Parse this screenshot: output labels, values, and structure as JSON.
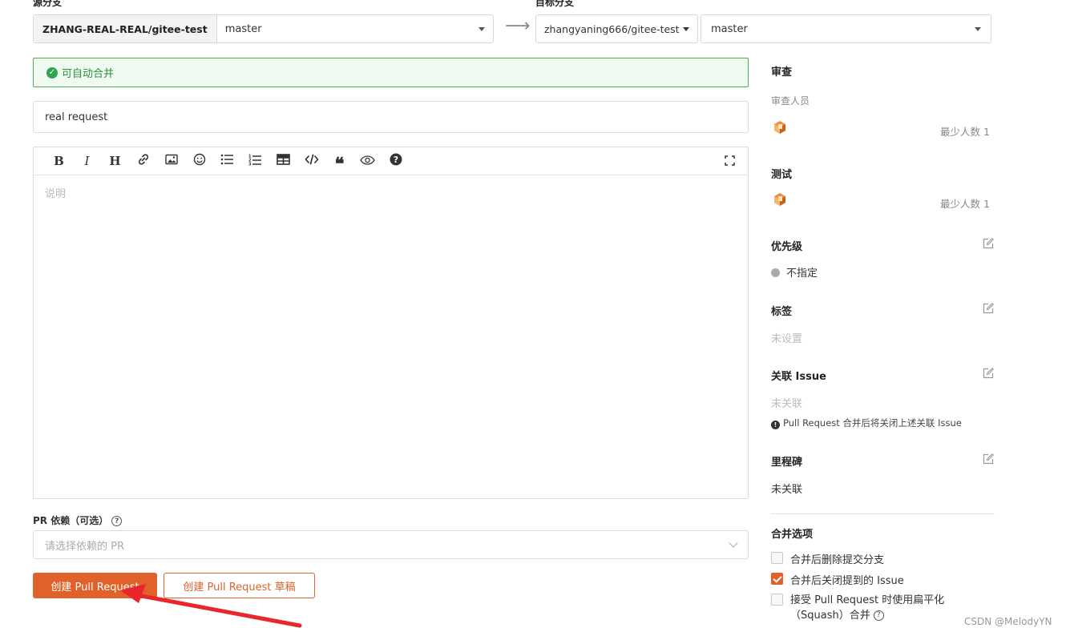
{
  "source": {
    "label": "源分支",
    "repo": "ZHANG-REAL-REAL/gitee-test",
    "branch": "master"
  },
  "target": {
    "label": "目标分支",
    "repo": "zhangyaning666/gitee-test",
    "branch": "master"
  },
  "merge_status": "可自动合并",
  "title_value": "real request",
  "editor": {
    "placeholder": "说明",
    "tools": [
      "bold",
      "italic",
      "heading",
      "link",
      "image",
      "emoji",
      "unordered-list",
      "ordered-list",
      "table",
      "code",
      "quote",
      "preview",
      "help",
      "fullscreen"
    ],
    "glyphs": {
      "bold": "B",
      "italic": "I",
      "heading": "H"
    }
  },
  "pr_dependency": {
    "label": "PR 依赖（可选）",
    "placeholder": "请选择依赖的 PR"
  },
  "buttons": {
    "create": "创建 Pull Request",
    "create_draft": "创建 Pull Request 草稿"
  },
  "sidebar": {
    "review": {
      "heading": "审查",
      "reviewers_label": "审查人员",
      "reviewers_min": "最少人数 1"
    },
    "test": {
      "heading": "测试",
      "min": "最少人数 1"
    },
    "priority": {
      "heading": "优先级",
      "value": "不指定"
    },
    "labels": {
      "heading": "标签",
      "value": "未设置"
    },
    "issue": {
      "heading": "关联 Issue",
      "value": "未关联",
      "note": "Pull Request 合并后将关闭上述关联 Issue"
    },
    "milestone": {
      "heading": "里程碑",
      "value": "未关联"
    },
    "merge_options": {
      "heading": "合并选项",
      "options": [
        {
          "label": "合并后删除提交分支",
          "checked": false
        },
        {
          "label": "合并后关闭提到的 Issue",
          "checked": true
        },
        {
          "label": "接受 Pull Request 时使用扁平化",
          "label2": "（Squash）合并",
          "checked": false
        }
      ]
    }
  },
  "watermark": "CSDN @MelodyYN",
  "colors": {
    "accent": "#e0622a",
    "success": "#2ea44f",
    "annotation_arrow": "#e8262b"
  }
}
